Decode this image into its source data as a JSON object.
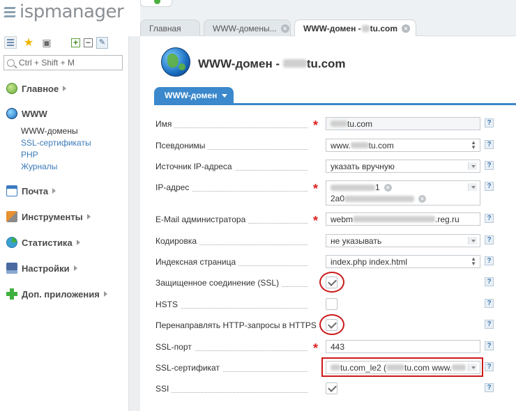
{
  "app": {
    "logo_text": "ispmanager"
  },
  "sidebar": {
    "search_placeholder": "Ctrl + Shift + M",
    "menu": [
      {
        "label": "Главное",
        "icon": "home-icon",
        "color": "#6aaa3a"
      },
      {
        "label": "WWW",
        "icon": "globe-icon",
        "color": "#3a8ad0"
      },
      {
        "label": "Почта",
        "icon": "mail-icon",
        "color": "#3a7ac0"
      },
      {
        "label": "Инструменты",
        "icon": "tools-icon",
        "color": "#d07a20"
      },
      {
        "label": "Статистика",
        "icon": "chart-pie-icon",
        "color": "#3aa0d0"
      },
      {
        "label": "Настройки",
        "icon": "settings-icon",
        "color": "#4a6aa0"
      },
      {
        "label": "Доп. приложения",
        "icon": "plus-icon",
        "color": "#40b040"
      }
    ],
    "www_submenu": [
      "WWW-домены",
      "SSL-сертификаты",
      "PHP",
      "Журналы"
    ]
  },
  "tabs": [
    {
      "label": "Главная"
    },
    {
      "label": "WWW-домены..."
    },
    {
      "label": "WWW-домен - ",
      "suffix": "tu.com"
    }
  ],
  "page": {
    "title_prefix": "WWW-домен - ",
    "title_suffix": "tu.com",
    "form_tab": "WWW-домен"
  },
  "form": {
    "name": {
      "label": "Имя",
      "value_suffix": "tu.com"
    },
    "aliases": {
      "label": "Псевдонимы",
      "value_prefix": "www.",
      "value_suffix": "tu.com"
    },
    "ip_source": {
      "label": "Источник IP-адреса",
      "value": "указать вручную"
    },
    "ip_address": {
      "label": "IP-адрес",
      "line1_suffix": "1",
      "line2_prefix": "2a0"
    },
    "admin_email": {
      "label": "E-Mail администратора",
      "value_prefix": "webm",
      "value_suffix": ".reg.ru"
    },
    "encoding": {
      "label": "Кодировка",
      "value": "не указывать"
    },
    "index_page": {
      "label": "Индексная страница",
      "value": "index.php index.html"
    },
    "ssl": {
      "label": "Защищенное соединение (SSL)",
      "checked": true
    },
    "hsts": {
      "label": "HSTS",
      "checked": false
    },
    "redirect_https": {
      "label": "Перенаправлять HTTP-запросы в HTTPS",
      "checked": true
    },
    "ssl_port": {
      "label": "SSL-порт",
      "value": "443"
    },
    "ssl_cert": {
      "label": "SSL-сертификат",
      "value_part1": "tu.com_le2 (",
      "value_part2": "tu.com www."
    },
    "ssi": {
      "label": "SSI",
      "checked": true
    },
    "help_glyph": "?",
    "required_glyph": "*"
  }
}
